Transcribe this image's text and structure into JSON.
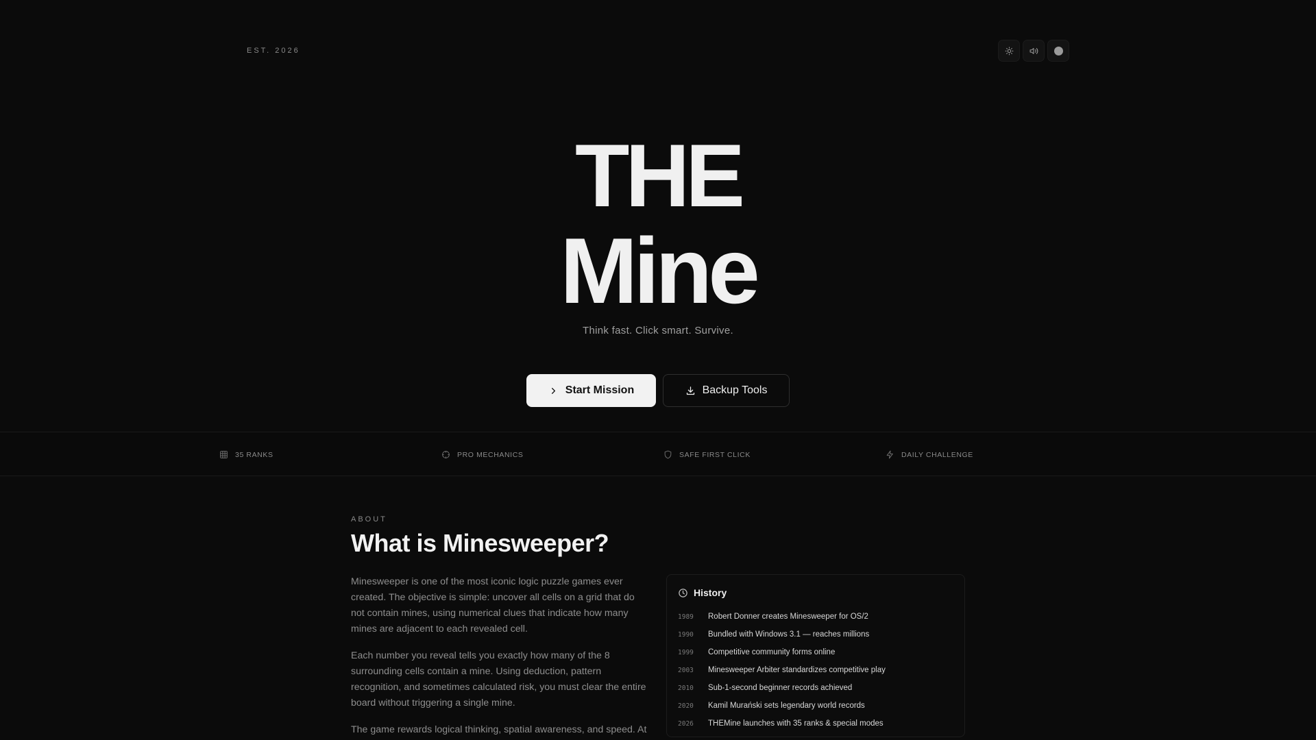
{
  "header": {
    "est": "EST. 2026",
    "controls": [
      {
        "name": "theme-toggle",
        "icon": "sun-icon"
      },
      {
        "name": "sound-toggle",
        "icon": "volume-icon"
      },
      {
        "name": "accent-toggle",
        "icon": "circle-icon"
      }
    ]
  },
  "hero": {
    "title_line1": "THE",
    "title_line2": "Mine",
    "tagline": "Think fast. Click smart. Survive.",
    "primary_button": "Start Mission",
    "secondary_button": "Backup Tools"
  },
  "features": [
    {
      "label": "35 RANKS",
      "icon": "grid-icon"
    },
    {
      "label": "PRO MECHANICS",
      "icon": "crosshair-icon"
    },
    {
      "label": "SAFE FIRST CLICK",
      "icon": "shield-icon"
    },
    {
      "label": "DAILY CHALLENGE",
      "icon": "zap-icon"
    }
  ],
  "about": {
    "label": "ABOUT",
    "title": "What is Minesweeper?",
    "paragraphs": [
      "Minesweeper is one of the most iconic logic puzzle games ever created. The objective is simple: uncover all cells on a grid that do not contain mines, using numerical clues that indicate how many mines are adjacent to each revealed cell.",
      "Each number you reveal tells you exactly how many of the 8 surrounding cells contain a mine. Using deduction, pattern recognition, and sometimes calculated risk, you must clear the entire board without triggering a single mine.",
      "The game rewards logical thinking, spatial awareness, and speed. At"
    ]
  },
  "history": {
    "title": "History",
    "items": [
      {
        "year": "1989",
        "event": "Robert Donner creates Minesweeper for OS/2"
      },
      {
        "year": "1990",
        "event": "Bundled with Windows 3.1 — reaches millions"
      },
      {
        "year": "1999",
        "event": "Competitive community forms online"
      },
      {
        "year": "2003",
        "event": "Minesweeper Arbiter standardizes competitive play"
      },
      {
        "year": "2010",
        "event": "Sub-1-second beginner records achieved"
      },
      {
        "year": "2020",
        "event": "Kamil Murański sets legendary world records"
      },
      {
        "year": "2026",
        "event": "THEMine launches with 35 ranks & special modes"
      }
    ]
  },
  "colors": {
    "background": "#0b0b0b",
    "primary_button_bg": "#f2f2f2",
    "text_muted": "#8e8e8e"
  }
}
